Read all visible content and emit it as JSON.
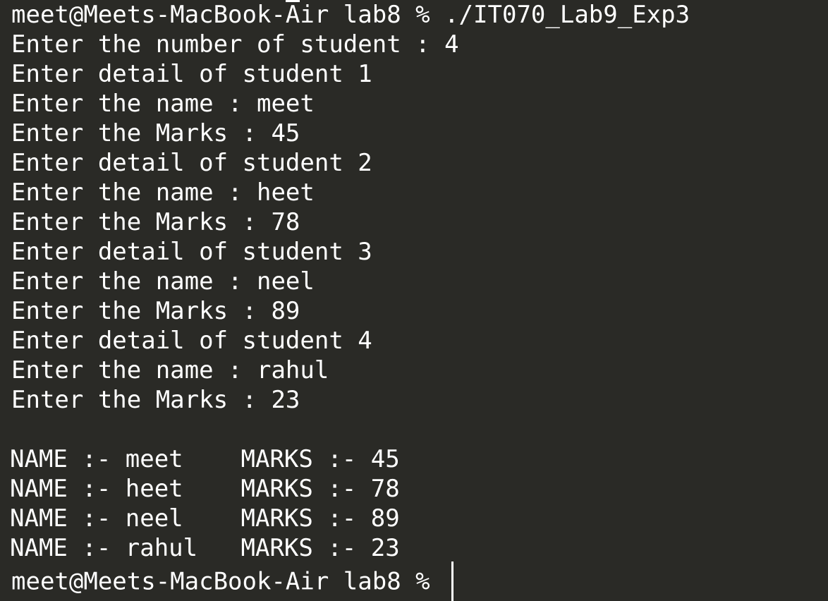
{
  "terminal": {
    "command_line": "meet@Meets-MacBook-Air lab8 % ./IT070_Lab9_Exp3",
    "input_lines": [
      "Enter the number of student : 4",
      "Enter detail of student 1",
      "Enter the name : meet",
      "Enter the Marks : 45",
      "Enter detail of student 2",
      "Enter the name : heet",
      "Enter the Marks : 78",
      "Enter detail of student 3",
      "Enter the name : neel",
      "Enter the Marks : 89",
      "Enter detail of student 4",
      "Enter the name : rahul",
      "Enter the Marks : 23"
    ],
    "results": [
      "NAME :- meet    MARKS :- 45",
      "NAME :- heet    MARKS :- 78",
      "NAME :- neel    MARKS :- 89",
      "NAME :- rahul   MARKS :- 23"
    ],
    "final_prompt": "meet@Meets-MacBook-Air lab8 % "
  },
  "colors": {
    "background": "#2a2a26",
    "text": "#ffffff"
  }
}
